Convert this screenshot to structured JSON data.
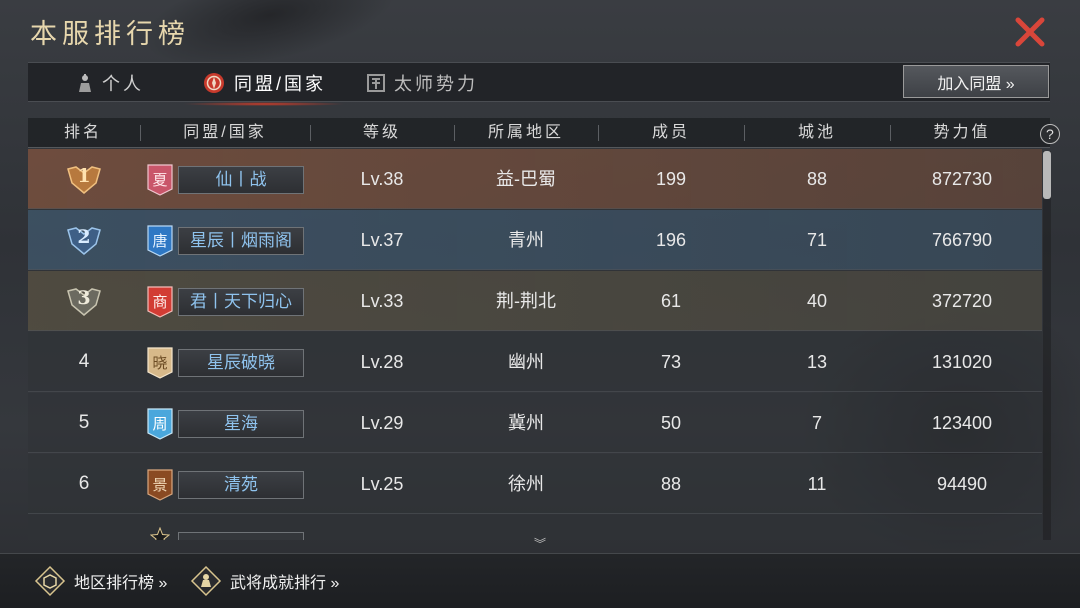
{
  "title": "本服排行榜",
  "tabs": [
    {
      "label": "个人",
      "icon": "person-icon",
      "active": false
    },
    {
      "label": "同盟/国家",
      "icon": "alliance-emblem-icon",
      "active": true
    },
    {
      "label": "太师势力",
      "icon": "faction-tower-icon",
      "active": false
    }
  ],
  "join_button": "加入同盟 »",
  "columns": [
    "排名",
    "同盟/国家",
    "等级",
    "所属地区",
    "成员",
    "城池",
    "势力值"
  ],
  "help": "?",
  "rows": [
    {
      "rank": "1",
      "banner_char": "夏",
      "banner_color": "#c9566a",
      "name": "仙丨战",
      "level": "Lv.38",
      "region": "益-巴蜀",
      "members": "199",
      "cities": "88",
      "power": "872730"
    },
    {
      "rank": "2",
      "banner_char": "唐",
      "banner_color": "#2f78c4",
      "name": "星辰丨烟雨阁",
      "level": "Lv.37",
      "region": "青州",
      "members": "196",
      "cities": "71",
      "power": "766790"
    },
    {
      "rank": "3",
      "banner_char": "商",
      "banner_color": "#d23c34",
      "name": "君丨天下归心",
      "level": "Lv.33",
      "region": "荆-荆北",
      "members": "61",
      "cities": "40",
      "power": "372720"
    },
    {
      "rank": "4",
      "banner_char": "晓",
      "banner_color": "#d7b98a",
      "name": "星辰破晓",
      "level": "Lv.28",
      "region": "幽州",
      "members": "73",
      "cities": "13",
      "power": "131020"
    },
    {
      "rank": "5",
      "banner_char": "周",
      "banner_color": "#4aa7dc",
      "name": "星海",
      "level": "Lv.29",
      "region": "冀州",
      "members": "50",
      "cities": "7",
      "power": "123400"
    },
    {
      "rank": "6",
      "banner_char": "景",
      "banner_color": "#8a4a22",
      "name": "清苑",
      "level": "Lv.25",
      "region": "徐州",
      "members": "88",
      "cities": "11",
      "power": "94490"
    }
  ],
  "bottom_links": [
    {
      "label": "地区排行榜 »",
      "icon": "region-ranking-icon"
    },
    {
      "label": "武将成就排行 »",
      "icon": "general-achievement-icon"
    }
  ],
  "colors": {
    "title_gold": "#e7d7ad",
    "close_red": "#d9463a",
    "name_blue": "#8fc3ee",
    "tab_active_glow": "#d63c28"
  }
}
